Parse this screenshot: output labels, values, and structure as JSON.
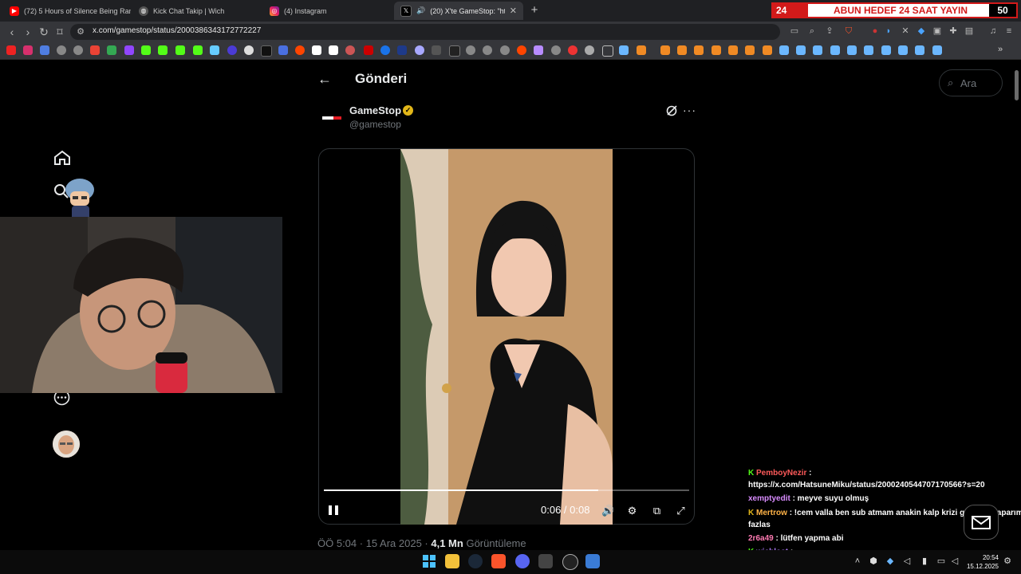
{
  "browser": {
    "tabs": [
      {
        "title": "(72) 5 Hours of Silence Being Randon",
        "icon": "youtube-icon"
      },
      {
        "title": "Kick Chat Takip | Wich",
        "icon": "globe-icon"
      },
      {
        "title": "(4) Instagram",
        "icon": "instagram-icon"
      },
      {
        "title": "(20) X'te GameStop: \"https://",
        "icon": "x-icon",
        "active": true
      }
    ],
    "url": "x.com/gamestop/status/2000386343172772227"
  },
  "banner": {
    "left_number": "24",
    "text": "ABUN HEDEF 24 SAAT YAYIN",
    "right_number": "50"
  },
  "page": {
    "title": "Gönderi",
    "search_placeholder": "Ara"
  },
  "post": {
    "author_name": "GameStop",
    "author_handle": "@gamestop",
    "video_time": "0:06 / 0:08",
    "video_progress": 0.75,
    "timestamp": "ÖÖ 5:04 · 15 Ara 2025 ·",
    "views_count": "4,1 Mn",
    "views_label": "Görüntüleme"
  },
  "chat": [
    {
      "badge": "K",
      "user": "PemboyNezir",
      "user_color": "#ff5a5a",
      "message": ":"
    },
    {
      "badge": "",
      "user": "",
      "user_color": "#ffffff",
      "message": "https://x.com/HatsuneMiku/status/2000240544707170566?s=20"
    },
    {
      "badge": "",
      "user": "xemptyedit",
      "user_color": "#d98cff",
      "message": ": meyve suyu olmuş"
    },
    {
      "badge": "K",
      "user": "Mertrow",
      "user_color": "#ffb347",
      "message": ": !cem valla ben sub atmam anakin kalp krizi gibi edit yaparım en"
    },
    {
      "badge": "",
      "user": "",
      "user_color": "#ffffff",
      "message": "fazlas"
    },
    {
      "badge": "",
      "user": "2r6a49",
      "user_color": "#ff7ab2",
      "message": ": lütfen yapma abi"
    },
    {
      "badge": "K",
      "user": "wichlost",
      "user_color": "#b07cff",
      "message": ":"
    }
  ],
  "taskbar": {
    "time": "20:54",
    "date": "15.12.2025"
  },
  "colors": {
    "accent_banner": "#d21a1a",
    "x_bg": "#000000",
    "verified_gold": "#e2b719"
  }
}
